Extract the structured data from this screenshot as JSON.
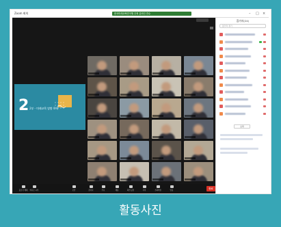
{
  "caption": "활동사진",
  "window": {
    "title": "Zoom 회의",
    "banner": "한국미래교육연구원 주최 온라인 연수"
  },
  "shared_screen": {
    "number": "2",
    "subtitle": "2부 - 미래교육 방향 토의"
  },
  "participants_panel": {
    "title": "참가자(24)",
    "search_placeholder": "참가자 찾기",
    "invite_label": "초대"
  },
  "toolbar": {
    "items": [
      {
        "icon": "microphone-icon",
        "label": "음소거 해제"
      },
      {
        "icon": "video-icon",
        "label": "비디오 시작"
      },
      {
        "icon": "shield-icon",
        "label": "보안"
      },
      {
        "icon": "participants-icon",
        "label": "참가자"
      },
      {
        "icon": "poll-icon",
        "label": "투표"
      },
      {
        "icon": "chat-icon",
        "label": "채팅"
      },
      {
        "icon": "share-screen-icon",
        "label": "화면 공유"
      },
      {
        "icon": "record-icon",
        "label": "기록"
      },
      {
        "icon": "breakout-icon",
        "label": "소회의실"
      },
      {
        "icon": "reactions-icon",
        "label": "반응"
      }
    ],
    "end_label": "종료"
  },
  "colors": {
    "background": "#37a6b6",
    "shared_screen": "#2b8aa2",
    "accent_square": "#e9b54a",
    "banner": "#2f7d34",
    "end_button": "#d93025"
  }
}
